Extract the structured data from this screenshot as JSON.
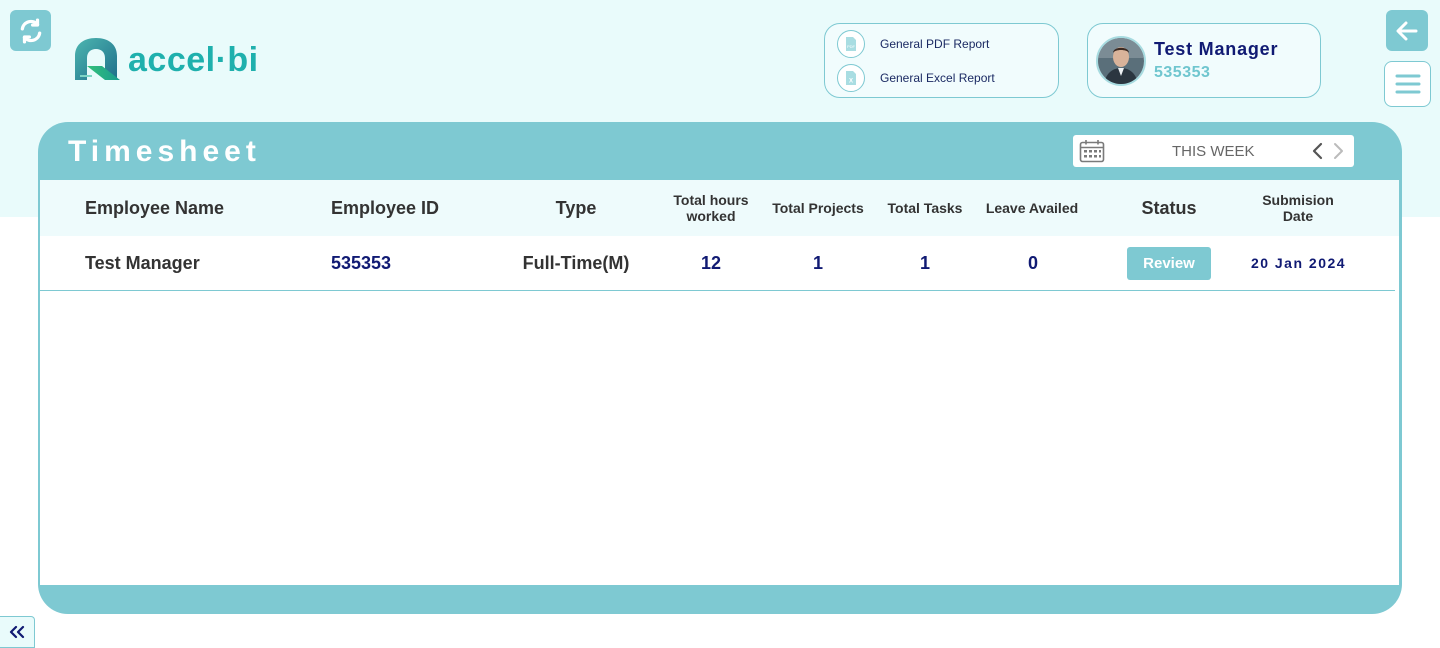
{
  "header": {
    "logo_text": "accel·bi",
    "refresh_icon": "refresh-icon",
    "back_icon": "arrow-left-icon",
    "menu_icon": "hamburger-menu-icon",
    "colors": {
      "accent": "#7ec9d2",
      "navy": "#101a73",
      "band": "#e9fbfb",
      "logo": "#1fb0ad"
    }
  },
  "reports": {
    "pdf_label": "General PDF Report",
    "excel_label": "General Excel Report",
    "pdf_icon": "pdf-file-icon",
    "excel_icon": "excel-file-icon"
  },
  "user": {
    "name": "Test Manager",
    "id": "535353",
    "avatar_icon": "user-avatar"
  },
  "timesheet": {
    "title": "Timesheet",
    "week_label": "THIS WEEK",
    "calendar_icon": "calendar-icon",
    "prev_icon": "chevron-left-icon",
    "next_icon": "chevron-right-icon",
    "columns": {
      "employee_name": "Employee Name",
      "employee_id": "Employee ID",
      "type": "Type",
      "total_hours_1": "Total hours",
      "total_hours_2": "worked",
      "total_projects": "Total Projects",
      "total_tasks": "Total Tasks",
      "leave_availed": "Leave Availed",
      "status": "Status",
      "submission_1": "Submision",
      "submission_2": "Date"
    },
    "rows": [
      {
        "employee_name": "Test Manager",
        "employee_id": "535353",
        "type": "Full-Time(M)",
        "total_hours": "12",
        "total_projects": "1",
        "total_tasks": "1",
        "leave_availed": "0",
        "status_button": "Review",
        "submission_date": "20 Jan 2024"
      }
    ]
  },
  "sidebar": {
    "collapse_icon": "double-chevron-left-icon"
  }
}
